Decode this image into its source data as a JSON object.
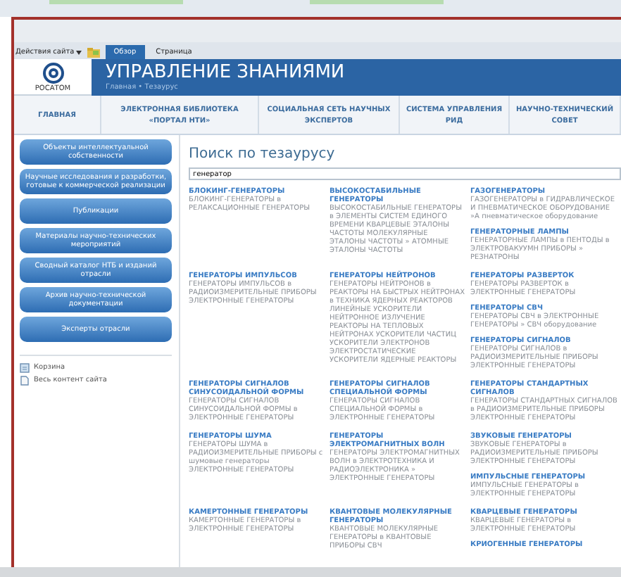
{
  "ribbon": {
    "menu": "Действия сайта",
    "tabs": [
      {
        "label": "Обзор",
        "selected": true
      },
      {
        "label": "Страница",
        "selected": false
      }
    ]
  },
  "site": {
    "logo_text": "РОСАТОМ",
    "title": "УПРАВЛЕНИЕ ЗНАНИЯМИ",
    "breadcrumb": "Главная • Тезаурус"
  },
  "nav": [
    "ГЛАВНАЯ",
    "ЭЛЕКТРОННАЯ БИБЛИОТЕКА «ПОРТАЛ НТИ»",
    "СОЦИАЛЬНАЯ СЕТЬ НАУЧНЫХ ЭКСПЕРТОВ",
    "СИСТЕМА УПРАВЛЕНИЯ РИД",
    "НАУЧНО-ТЕХНИЧЕСКИЙ СОВЕТ"
  ],
  "sidebar": {
    "buttons": [
      "Объекты интеллектуальной собственности",
      "Научные исследования и разработки, готовые к коммерческой реализации",
      "Публикации",
      "Материалы научно-технических мероприятий",
      "Сводный каталог НТБ и изданий отрасли",
      "Архив научно-технической документации",
      "Эксперты отрасли"
    ],
    "links": [
      {
        "label": "Корзина",
        "kind": "bin"
      },
      {
        "label": "Весь контент сайта",
        "kind": "content"
      }
    ]
  },
  "search": {
    "title": "Поиск по тезаурусу",
    "value": "генератор"
  },
  "results": [
    [
      [
        {
          "term": "БЛОКИНГ-ГЕНЕРАТОРЫ",
          "related": "БЛОКИНГ-ГЕНЕРАТОРЫ в РЕЛАКСАЦИОННЫЕ ГЕНЕРАТОРЫ"
        }
      ],
      [
        {
          "term": "ВЫСОКОСТАБИЛЬНЫЕ ГЕНЕРАТОРЫ",
          "related": "ВЫСОКОСТАБИЛЬНЫЕ ГЕНЕРАТОРЫ в ЭЛЕМЕНТЫ СИСТЕМ ЕДИНОГО ВРЕМЕНИ КВАРЦЕВЫЕ ЭТАЛОНЫ ЧАСТОТЫ МОЛЕКУЛЯРНЫЕ ЭТАЛОНЫ ЧАСТОТЫ » АТОМНЫЕ ЭТАЛОНЫ ЧАСТОТЫ"
        }
      ],
      [
        {
          "term": "ГАЗОГЕНЕРАТОРЫ",
          "related": "ГАЗОГЕНЕРАТОРЫ в ГИДРАВЛИЧЕСКОЕ И ПНЕВМАТИЧЕСКОЕ ОБОРУДОВАНИЕ »А пневматическое оборудование"
        },
        {
          "term": "ГЕНЕРАТОРНЫЕ ЛАМПЫ",
          "related": "ГЕНЕРАТОРНЫЕ ЛАМПЫ в ПЕНТОДЫ в ЭЛЕКТРОВАКУУМН ПРИБОРЫ » РЕЗНАТРОНЫ"
        }
      ]
    ],
    [
      [
        {
          "term": "ГЕНЕРАТОРЫ ИМПУЛЬСОВ",
          "related": "ГЕНЕРАТОРЫ ИМПУЛЬСОВ в РАДИОИЗМЕРИТЕЛЬНЫЕ ПРИБОРЫ ЭЛЕКТРОННЫЕ ГЕНЕРАТОРЫ"
        }
      ],
      [
        {
          "term": "ГЕНЕРАТОРЫ НЕЙТРОНОВ",
          "related": "ГЕНЕРАТОРЫ НЕЙТРОНОВ в РЕАКТОРЫ НА БЫСТРЫХ НЕЙТРОНАХ в ТЕХНИКА ЯДЕРНЫХ РЕАКТОРОВ ЛИНЕЙНЫЕ УСКОРИТЕЛИ НЕЙТРОННОЕ ИЗЛУЧЕНИЕ РЕАКТОРЫ НА ТЕПЛОВЫХ НЕЙТРОНАХ УСКОРИТЕЛИ ЧАСТИЦ УСКОРИТЕЛИ ЭЛЕКТРОНОВ ЭЛЕКТРОСТАТИЧЕСКИЕ УСКОРИТЕЛИ ЯДЕРНЫЕ РЕАКТОРЫ"
        }
      ],
      [
        {
          "term": "ГЕНЕРАТОРЫ РАЗВЕРТОК",
          "related": "ГЕНЕРАТОРЫ РАЗВЕРТОК в ЭЛЕКТРОННЫЕ ГЕНЕРАТОРЫ"
        },
        {
          "term": "ГЕНЕРАТОРЫ СВЧ",
          "related": "ГЕНЕРАТОРЫ СВЧ в ЭЛЕКТРОННЫЕ ГЕНЕРАТОРЫ » СВЧ оборудование"
        },
        {
          "term": "ГЕНЕРАТОРЫ СИГНАЛОВ",
          "related": "ГЕНЕРАТОРЫ СИГНАЛОВ в РАДИОИЗМЕРИТЕЛЬНЫЕ ПРИБОРЫ ЭЛЕКТРОННЫЕ ГЕНЕРАТОРЫ"
        }
      ]
    ],
    [
      [
        {
          "term": "ГЕНЕРАТОРЫ СИГНАЛОВ СИНУСОИДАЛЬНОЙ ФОРМЫ",
          "related": "ГЕНЕРАТОРЫ СИГНАЛОВ СИНУСОИДАЛЬНОЙ ФОРМЫ в ЭЛЕКТРОННЫЕ ГЕНЕРАТОРЫ"
        }
      ],
      [
        {
          "term": "ГЕНЕРАТОРЫ СИГНАЛОВ СПЕЦИАЛЬНОЙ ФОРМЫ",
          "related": "ГЕНЕРАТОРЫ СИГНАЛОВ СПЕЦИАЛЬНОЙ ФОРМЫ в ЭЛЕКТРОННЫЕ ГЕНЕРАТОРЫ"
        }
      ],
      [
        {
          "term": "ГЕНЕРАТОРЫ СТАНДАРТНЫХ СИГНАЛОВ",
          "related": "ГЕНЕРАТОРЫ СТАНДАРТНЫХ СИГНАЛОВ в РАДИОИЗМЕРИТЕЛЬНЫЕ ПРИБОРЫ ЭЛЕКТРОННЫЕ ГЕНЕРАТОРЫ"
        }
      ]
    ],
    [
      [
        {
          "term": "ГЕНЕРАТОРЫ ШУМА",
          "related": "ГЕНЕРАТОРЫ ШУМА в РАДИОИЗМЕРИТЕЛЬНЫЕ ПРИБОРЫ с шумовые генераторы ЭЛЕКТРОННЫЕ ГЕНЕРАТОРЫ"
        }
      ],
      [
        {
          "term": "ГЕНЕРАТОРЫ ЭЛЕКТРОМАГНИТНЫХ ВОЛН",
          "related": "ГЕНЕРАТОРЫ ЭЛЕКТРОМАГНИТНЫХ ВОЛН в ЭЛЕКТРОТЕХНИКА И РАДИОЭЛЕКТРОНИКА » ЭЛЕКТРОННЫЕ ГЕНЕРАТОРЫ"
        }
      ],
      [
        {
          "term": "ЗВУКОВЫЕ ГЕНЕРАТОРЫ",
          "related": "ЗВУКОВЫЕ ГЕНЕРАТОРЫ в РАДИОИЗМЕРИТЕЛЬНЫЕ ПРИБОРЫ ЭЛЕКТРОННЫЕ ГЕНЕРАТОРЫ"
        },
        {
          "term": "ИМПУЛЬСНЫЕ ГЕНЕРАТОРЫ",
          "related": "ИМПУЛЬСНЫЕ ГЕНЕРАТОРЫ в ЭЛЕКТРОННЫЕ ГЕНЕРАТОРЫ"
        }
      ]
    ],
    [
      [
        {
          "term": "КАМЕРТОННЫЕ ГЕНЕРАТОРЫ",
          "related": "КАМЕРТОННЫЕ ГЕНЕРАТОРЫ в ЭЛЕКТРОННЫЕ ГЕНЕРАТОРЫ"
        }
      ],
      [
        {
          "term": "КВАНТОВЫЕ МОЛЕКУЛЯРНЫЕ ГЕНЕРАТОРЫ",
          "related": "КВАНТОВЫЕ МОЛЕКУЛЯРНЫЕ ГЕНЕРАТОРЫ в КВАНТОВЫЕ ПРИБОРЫ СВЧ"
        }
      ],
      [
        {
          "term": "КВАРЦЕВЫЕ ГЕНЕРАТОРЫ",
          "related": "КВАРЦЕВЫЕ ГЕНЕРАТОРЫ в ЭЛЕКТРОННЫЕ ГЕНЕРАТОРЫ"
        },
        {
          "term": "КРИОГЕННЫЕ ГЕНЕРАТОРЫ"
        }
      ]
    ]
  ]
}
